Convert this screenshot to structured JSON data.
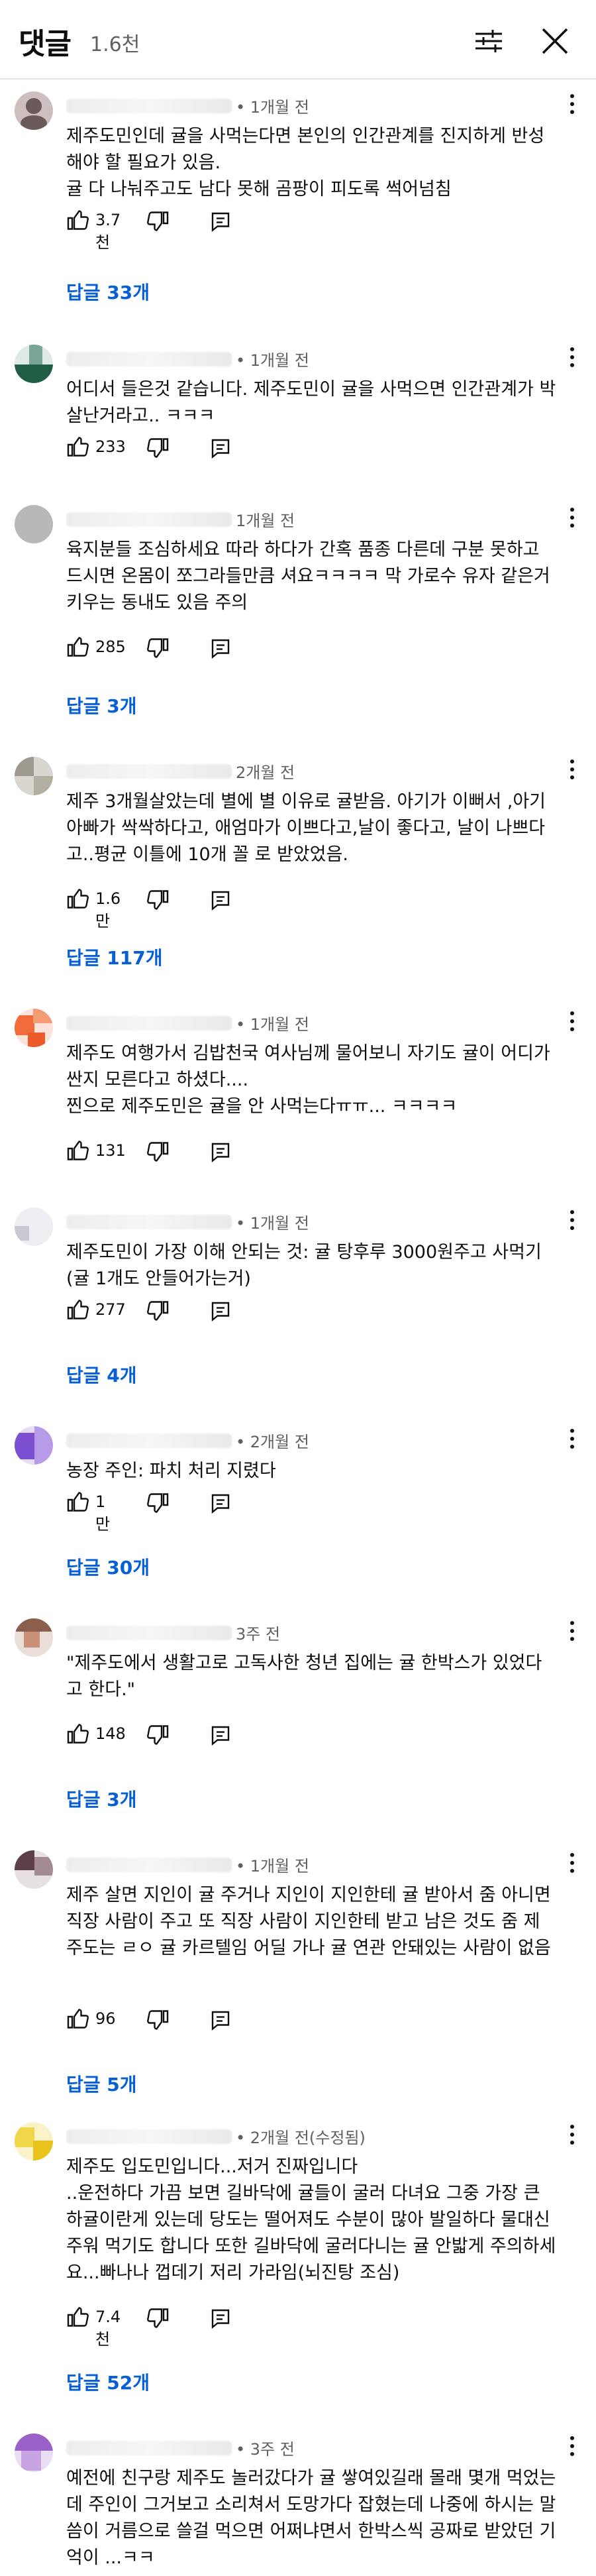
{
  "header": {
    "title": "댓글",
    "count": "1.6천",
    "filter_icon": "tune-icon",
    "close_icon": "close-icon"
  },
  "comments": [
    {
      "time": "• 1개월 전",
      "text": "제주도민인데 귤을 사먹는다면 본인의 인간관계를 진지하게 반성해야 할 필요가 있음.\n귤 다 나눠주고도 남다 못해 곰팡이 피도록 썩어넘침",
      "likes": "3.7천",
      "replies": "답글 33개"
    },
    {
      "time": "• 1개월 전",
      "text": "어디서 들은것 같습니다. 제주도민이 귤을 사먹으면 인간관계가 박살난거라고.. ㅋㅋㅋ",
      "likes": "233",
      "replies": ""
    },
    {
      "time": "1개월 전",
      "text": "육지분들 조심하세요 따라 하다가 간혹 품종 다른데 구분 못하고 드시면 온몸이 쪼그라들만큼 셔요ㅋㅋㅋㅋ 막 가로수 유자 같은거 키우는 동내도 있음 주의",
      "likes": "285",
      "replies": "답글 3개"
    },
    {
      "time": "2개월 전",
      "text": "제주 3개월살았는데 별에 별 이유로 귤받음. 아기가 이뻐서 ,아기아빠가 싹싹하다고, 애엄마가 이쁘다고,날이 좋다고, 날이 나쁘다고..평균 이틀에 10개 꼴 로 받았었음.",
      "likes": "1.6만",
      "replies": "답글 117개"
    },
    {
      "time": "• 1개월 전",
      "text": "제주도 여행가서 김밥천국 여사님께 물어보니 자기도 귤이 어디가 싼지 모른다고 하셨다....\n찐으로 제주도민은 귤을 안 사먹는다ㅠㅠ... ㅋㅋㅋㅋ",
      "likes": "131",
      "replies": ""
    },
    {
      "time": "• 1개월 전",
      "text": "제주도민이 가장 이해 안되는 것: 귤 탕후루 3000원주고 사먹기(귤 1개도 안들어가는거)",
      "likes": "277",
      "replies": "답글 4개"
    },
    {
      "time": "• 2개월 전",
      "text": "농장 주인: 파치 처리 지렸다",
      "likes": "1만",
      "replies": "답글 30개"
    },
    {
      "time": "3주 전",
      "text": "\"제주도에서 생활고로 고독사한 청년 집에는 귤 한박스가 있었다고 한다.\"",
      "likes": "148",
      "replies": "답글 3개"
    },
    {
      "time": "• 1개월 전",
      "text": "제주 살면 지인이 귤 주거나 지인이 지인한테 귤 받아서 줌 아니면 직장 사람이 주고 또 직장 사람이 지인한테 받고 남은 것도 줌 제주도는 ㄹㅇ 귤 카르텔임 어딜 가나 귤 연관 안돼있는 사람이 없음",
      "likes": "96",
      "replies": "답글 5개"
    },
    {
      "time": "• 2개월 전(수정됨)",
      "text": "제주도 입도민입니다...저거 진짜입니다\n..운전하다 가끔 보면 길바닥에 귤들이 굴러 다녀요 그중 가장 큰 하귤이란게 있는데 당도는 떨어져도 수분이 많아 발일하다 물대신 주워 먹기도 합니다 또한 길바닥에 굴러다니는 귤 안밟게 주의하세요...빠나나 껍데기 저리 가라임(뇌진탕 조심)",
      "likes": "7.4천",
      "replies": "답글 52개"
    },
    {
      "time": "• 3주 전",
      "text": "예전에 친구랑 제주도 놀러갔다가 귤 쌓여있길래 몰래 몇개 먹었는데 주인이 그거보고 소리쳐서 도망가다 잡혔는데 나중에 하시는 말씀이 거름으로 쓸걸 먹으면 어쩌냐면서 한박스씩 공짜로 받았던 기억이 ...ㅋㅋ",
      "likes": "",
      "replies": ""
    }
  ],
  "colors": {
    "text": "#0f0f0f",
    "muted": "#606060",
    "link": "#065fd4",
    "divider": "#e5e5e5"
  },
  "icons": {
    "like": "thumb-up-icon",
    "dislike": "thumb-down-icon",
    "reply": "reply-icon",
    "menu": "more-vert-icon"
  }
}
